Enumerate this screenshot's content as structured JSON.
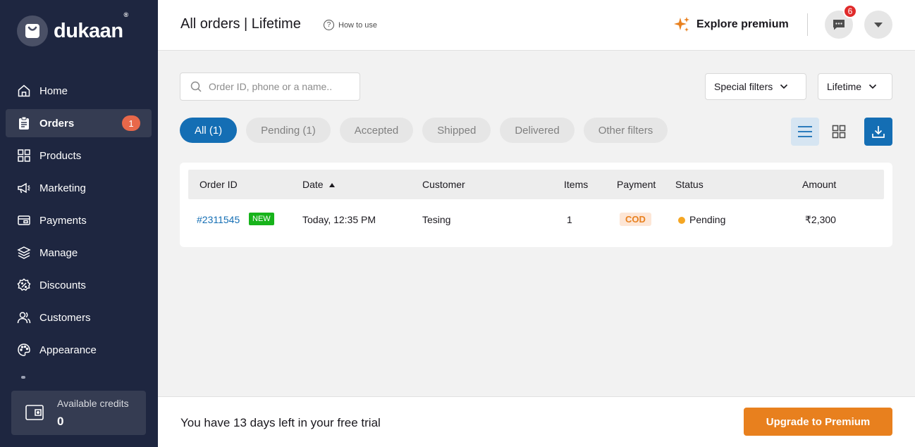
{
  "brand": {
    "name": "dukaan",
    "registered": "®"
  },
  "sidebar": {
    "items": [
      {
        "label": "Home",
        "icon": "home-icon"
      },
      {
        "label": "Orders",
        "icon": "clipboard-icon",
        "badge": "1",
        "active": true
      },
      {
        "label": "Products",
        "icon": "grid-icon"
      },
      {
        "label": "Marketing",
        "icon": "megaphone-icon"
      },
      {
        "label": "Payments",
        "icon": "payments-icon"
      },
      {
        "label": "Manage",
        "icon": "layers-icon"
      },
      {
        "label": "Discounts",
        "icon": "discount-icon"
      },
      {
        "label": "Customers",
        "icon": "users-icon"
      },
      {
        "label": "Appearance",
        "icon": "palette-icon"
      }
    ],
    "credits": {
      "label": "Available credits",
      "value": "0"
    }
  },
  "header": {
    "title": "All orders | Lifetime",
    "how_to_use": "How to use",
    "explore_premium": "Explore premium",
    "notification_count": "6"
  },
  "filters": {
    "search_placeholder": "Order ID, phone or a name..",
    "special_filters": "Special filters",
    "period": "Lifetime",
    "tabs": [
      {
        "label": "All (1)",
        "active": true
      },
      {
        "label": "Pending (1)"
      },
      {
        "label": "Accepted"
      },
      {
        "label": "Shipped"
      },
      {
        "label": "Delivered"
      },
      {
        "label": "Other filters"
      }
    ]
  },
  "table": {
    "columns": [
      "Order ID",
      "Date",
      "Customer",
      "Items",
      "Payment",
      "Status",
      "Amount"
    ],
    "rows": [
      {
        "order_id": "#2311545",
        "new_label": "NEW",
        "date": "Today, 12:35 PM",
        "customer": "Tesing",
        "items": "1",
        "payment": "COD",
        "status": "Pending",
        "amount": "₹2,300"
      }
    ]
  },
  "footer": {
    "trial_text": "You have 13 days left in your free trial",
    "upgrade_label": "Upgrade to Premium"
  },
  "colors": {
    "sidebar_bg": "#1e2640",
    "accent": "#146eb4",
    "premium": "#e8801e",
    "pending": "#f5a623",
    "new": "#17b31b"
  }
}
